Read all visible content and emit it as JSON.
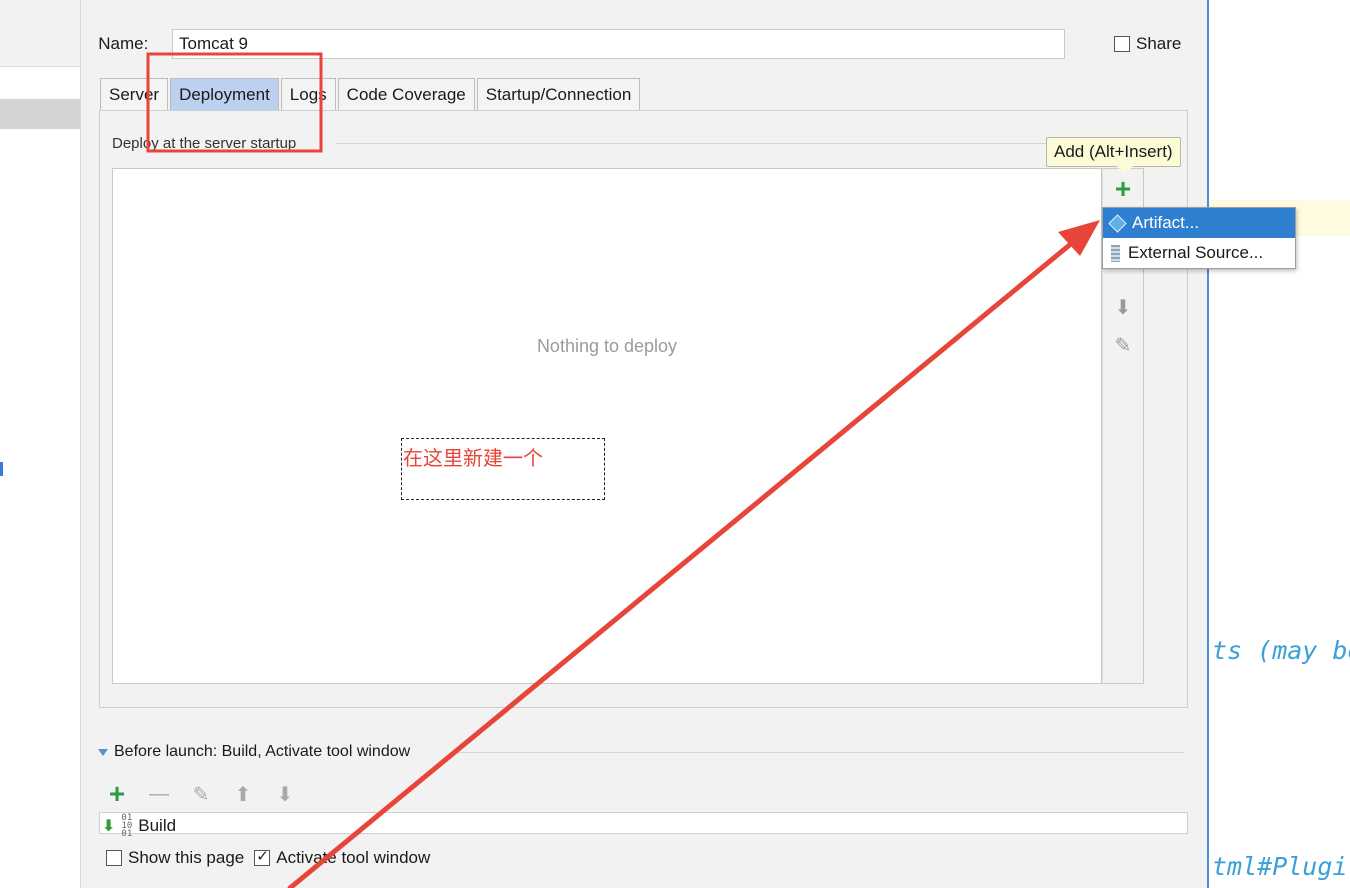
{
  "dialog": {
    "name_label": "Name:",
    "name_value": "Tomcat 9",
    "share_label": "Share",
    "share_checked": false
  },
  "tabs": [
    {
      "label": "Server",
      "active": false
    },
    {
      "label": "Deployment",
      "active": true
    },
    {
      "label": "Logs",
      "active": false
    },
    {
      "label": "Code Coverage",
      "active": false
    },
    {
      "label": "Startup/Connection",
      "active": false
    }
  ],
  "deployment": {
    "group_title": "Deploy at the server startup",
    "empty_text": "Nothing to deploy",
    "toolbar_icons": [
      "plus-icon",
      "minus-icon",
      "arrow-up-icon",
      "arrow-down-icon",
      "pencil-icon"
    ]
  },
  "tooltip": {
    "text": "Add (Alt+Insert)"
  },
  "popup_menu": {
    "items": [
      {
        "label": "Artifact...",
        "icon": "artifact-icon",
        "highlighted": true
      },
      {
        "label": "External Source...",
        "icon": "external-source-icon",
        "highlighted": false
      }
    ]
  },
  "annotation": {
    "text": "在这里新建一个",
    "color": "#e8453a"
  },
  "before_launch": {
    "title": "Before launch: Build, Activate tool window",
    "toolbar_icons": [
      "plus-icon",
      "minus-icon",
      "pencil-icon",
      "arrow-up-icon",
      "arrow-down-icon"
    ],
    "items": [
      "Build"
    ]
  },
  "bottom": {
    "show_page_label": "Show this page",
    "show_page_checked": false,
    "activate_label": "Activate tool window",
    "activate_checked": true
  },
  "background_code": {
    "line1": "ts (may be",
    "line2": "tml#Plugi"
  },
  "colors": {
    "active_tab": "#bcd0f0",
    "menu_highlight": "#2f7fd1",
    "annotation_red": "#e8453a",
    "code_blue": "#3aa0d8"
  }
}
